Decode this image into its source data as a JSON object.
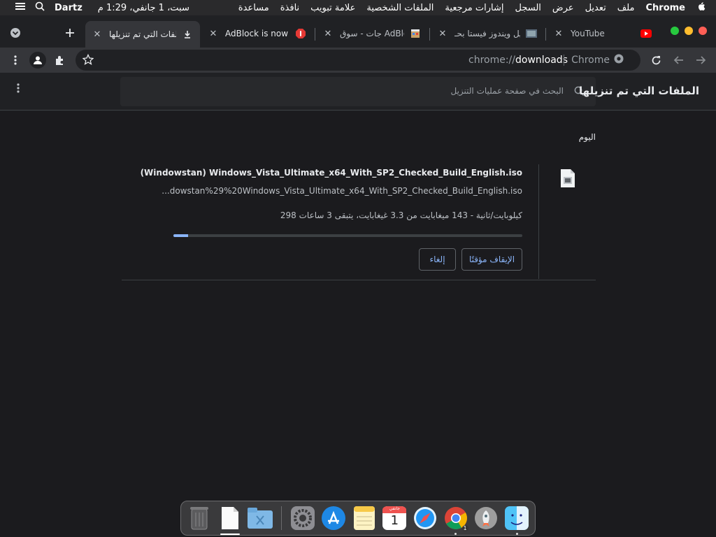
{
  "menubar": {
    "app_name": "Chrome",
    "items": [
      "ملف",
      "تعديل",
      "عرض",
      "السجل",
      "إشارات مرجعية",
      "الملفات الشخصية",
      "علامة تبويب",
      "نافذة",
      "مساعدة"
    ],
    "clock": "سبت، 1 جانفي، 1:29 م",
    "user": "Dartz",
    "apple_icon": "apple-icon",
    "search_icon": "search-icon",
    "control_icon": "control-center-icon"
  },
  "tabs": [
    {
      "title": "YouTube",
      "favicon": "youtube-icon"
    },
    {
      "title": "تحميل ويندوز فيستا بحـ",
      "favicon": "windows-icon"
    },
    {
      "title": "جات - سوق AdBlock",
      "favicon": "store-icon"
    },
    {
      "title": "AdBlock is now in",
      "favicon": "adblock-icon"
    },
    {
      "title": "الملفات التي تم تنزيلها",
      "favicon": "download-icon"
    }
  ],
  "omnibox": {
    "scheme": "chrome://",
    "host": "downloads",
    "chip_label": "Chrome"
  },
  "downloads": {
    "title": "الملفات التي تم تنزيلها",
    "search_placeholder": "البحث في صفحة عمليات التنزيل",
    "section": "اليوم",
    "item": {
      "file_name": "(Windowstan) Windows_Vista_Ultimate_x64_With_SP2_Checked_Build_English.iso",
      "url": "...dowstan%29%20Windows_Vista_Ultimate_x64_With_SP2_Checked_Build_English.iso",
      "status": "298 كيلوبايت/ثانية - 143 ميغابايت من 3.3 غيغابايت، يتبقى 3 ساعات",
      "progress_fraction": 0.042,
      "pause_label": "الإيقاف مؤقتًا",
      "cancel_label": "إلغاء"
    }
  },
  "dock": {
    "apps": [
      "finder-icon",
      "launchpad-icon",
      "chrome-icon",
      "safari-icon",
      "calendar-icon",
      "notes-icon",
      "app-store-icon",
      "system-preferences-icon"
    ],
    "calendar_month": "جانفي",
    "calendar_day": "1",
    "chrome_badge": "1"
  },
  "colors": {
    "accent": "#8ab4f8",
    "window_bg": "#202124",
    "page_bg": "#1b1b1e"
  }
}
